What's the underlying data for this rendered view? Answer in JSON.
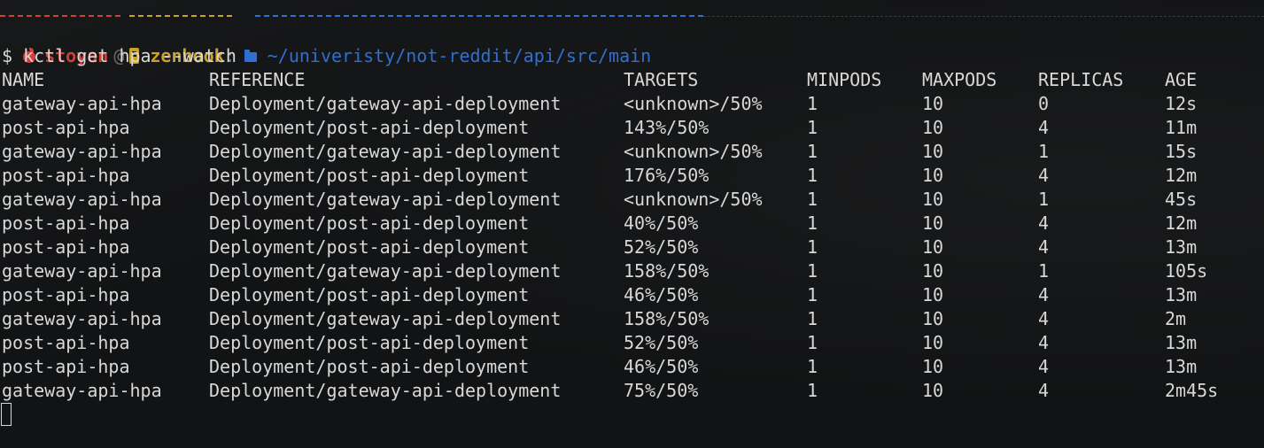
{
  "prompt": {
    "user": "stoyan",
    "at": "@",
    "host": "zenbook",
    "colon": ":",
    "path": "~/univeristy/not-reddit/api/src/main",
    "icons": [
      "apple-icon",
      "laptop-icon",
      "folder-icon"
    ],
    "colors": {
      "user": "#d0413a",
      "host": "#c9a227",
      "path": "#2f6fd1"
    }
  },
  "command": "$ kctl get hpa --watch",
  "table": {
    "headers": [
      "NAME",
      "REFERENCE",
      "TARGETS",
      "MINPODS",
      "MAXPODS",
      "REPLICAS",
      "AGE"
    ],
    "rows": [
      [
        "gateway-api-hpa",
        "Deployment/gateway-api-deployment",
        "<unknown>/50%",
        "1",
        "10",
        "0",
        "12s"
      ],
      [
        "post-api-hpa",
        "Deployment/post-api-deployment",
        "143%/50%",
        "1",
        "10",
        "4",
        "11m"
      ],
      [
        "gateway-api-hpa",
        "Deployment/gateway-api-deployment",
        "<unknown>/50%",
        "1",
        "10",
        "1",
        "15s"
      ],
      [
        "post-api-hpa",
        "Deployment/post-api-deployment",
        "176%/50%",
        "1",
        "10",
        "4",
        "12m"
      ],
      [
        "gateway-api-hpa",
        "Deployment/gateway-api-deployment",
        "<unknown>/50%",
        "1",
        "10",
        "1",
        "45s"
      ],
      [
        "post-api-hpa",
        "Deployment/post-api-deployment",
        "40%/50%",
        "1",
        "10",
        "4",
        "12m"
      ],
      [
        "post-api-hpa",
        "Deployment/post-api-deployment",
        "52%/50%",
        "1",
        "10",
        "4",
        "13m"
      ],
      [
        "gateway-api-hpa",
        "Deployment/gateway-api-deployment",
        "158%/50%",
        "1",
        "10",
        "1",
        "105s"
      ],
      [
        "post-api-hpa",
        "Deployment/post-api-deployment",
        "46%/50%",
        "1",
        "10",
        "4",
        "13m"
      ],
      [
        "gateway-api-hpa",
        "Deployment/gateway-api-deployment",
        "158%/50%",
        "1",
        "10",
        "4",
        "2m"
      ],
      [
        "post-api-hpa",
        "Deployment/post-api-deployment",
        "52%/50%",
        "1",
        "10",
        "4",
        "13m"
      ],
      [
        "post-api-hpa",
        "Deployment/post-api-deployment",
        "46%/50%",
        "1",
        "10",
        "4",
        "13m"
      ],
      [
        "gateway-api-hpa",
        "Deployment/gateway-api-deployment",
        "75%/50%",
        "1",
        "10",
        "4",
        "2m45s"
      ]
    ]
  }
}
